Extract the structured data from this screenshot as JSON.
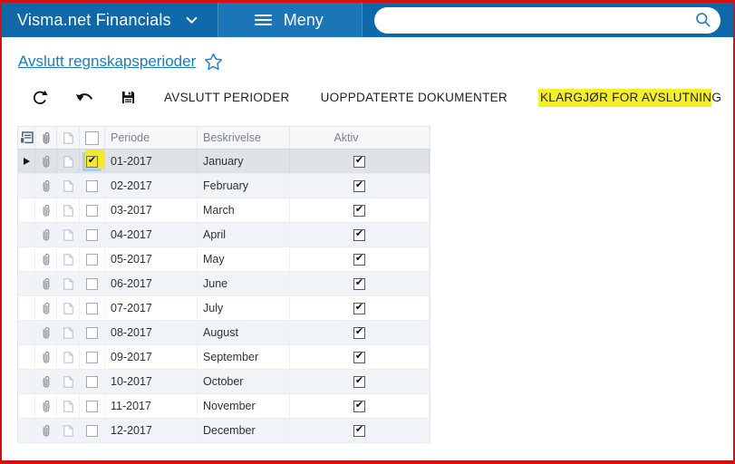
{
  "topbar": {
    "app_title": "Visma.net Financials",
    "menu_label": "Meny",
    "search_value": ""
  },
  "page": {
    "title": "Avslutt regnskapsperioder"
  },
  "toolbar": {
    "buttons": [
      {
        "label": "AVSLUTT PERIODER",
        "highlighted": false
      },
      {
        "label": "UOPPDATERTE DOKUMENTER",
        "highlighted": false
      },
      {
        "label": "KLARGJØR FOR AVSLUTNING",
        "highlighted": true,
        "highlight_segment": "KLARGJØR FOR AVSLUTNIN",
        "tail_segment": "G"
      }
    ]
  },
  "table": {
    "columns": {
      "periode": "Periode",
      "beskrivelse": "Beskrivelse",
      "aktiv": "Aktiv"
    },
    "rows": [
      {
        "periode": "01-2017",
        "beskrivelse": "January",
        "aktiv": true,
        "selected": true,
        "checked": true
      },
      {
        "periode": "02-2017",
        "beskrivelse": "February",
        "aktiv": true,
        "selected": false,
        "checked": false
      },
      {
        "periode": "03-2017",
        "beskrivelse": "March",
        "aktiv": true,
        "selected": false,
        "checked": false
      },
      {
        "periode": "04-2017",
        "beskrivelse": "April",
        "aktiv": true,
        "selected": false,
        "checked": false
      },
      {
        "periode": "05-2017",
        "beskrivelse": "May",
        "aktiv": true,
        "selected": false,
        "checked": false
      },
      {
        "periode": "06-2017",
        "beskrivelse": "June",
        "aktiv": true,
        "selected": false,
        "checked": false
      },
      {
        "periode": "07-2017",
        "beskrivelse": "July",
        "aktiv": true,
        "selected": false,
        "checked": false
      },
      {
        "periode": "08-2017",
        "beskrivelse": "August",
        "aktiv": true,
        "selected": false,
        "checked": false
      },
      {
        "periode": "09-2017",
        "beskrivelse": "September",
        "aktiv": true,
        "selected": false,
        "checked": false
      },
      {
        "periode": "10-2017",
        "beskrivelse": "October",
        "aktiv": true,
        "selected": false,
        "checked": false
      },
      {
        "periode": "11-2017",
        "beskrivelse": "November",
        "aktiv": true,
        "selected": false,
        "checked": false
      },
      {
        "periode": "12-2017",
        "beskrivelse": "December",
        "aktiv": true,
        "selected": false,
        "checked": false
      }
    ]
  },
  "colors": {
    "topbar": "#0f68a9",
    "topbar_menu_segment": "#1a76b6",
    "link_blue": "#1a7cc0",
    "highlight_yellow": "#f5ee2b",
    "selected_row": "#dfe2e6",
    "row_stripe": "#f0f4f9",
    "frame_border_red": "#d41010"
  }
}
